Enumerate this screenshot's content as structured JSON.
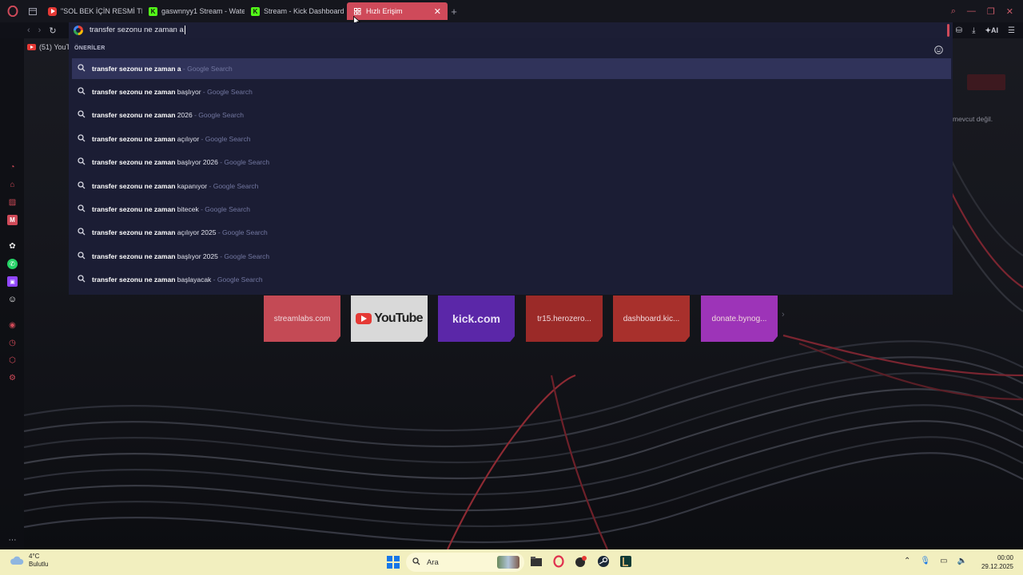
{
  "tabs": [
    {
      "label": "\"SOL BEK İÇİN RESMİ TEK",
      "favicon": "youtube-icon",
      "active": false
    },
    {
      "label": "gaswnnyy1 Stream - Wate",
      "favicon": "kick-icon",
      "active": false
    },
    {
      "label": "Stream - Kick Dashboard",
      "favicon": "kick-icon",
      "active": false
    },
    {
      "label": "Hızlı Erişim",
      "favicon": "speed-dial-icon",
      "active": true
    }
  ],
  "address_bar": {
    "value": "transfer sezonu ne zaman a"
  },
  "bookmark": {
    "label": "(51) YouTu"
  },
  "suggestions": {
    "header": "ÖNERİLER",
    "items": [
      {
        "bold": "transfer sezonu ne zaman a",
        "rest": "",
        "source": "Google Search"
      },
      {
        "bold": "transfer sezonu ne zaman",
        "rest": "başlıyor",
        "source": "Google Search"
      },
      {
        "bold": "transfer sezonu ne zaman",
        "rest": "2026",
        "source": "Google Search"
      },
      {
        "bold": "transfer sezonu ne zaman",
        "rest": "açılıyor",
        "source": "Google Search"
      },
      {
        "bold": "transfer sezonu ne zaman",
        "rest": "başlıyor 2026",
        "source": "Google Search"
      },
      {
        "bold": "transfer sezonu ne zaman",
        "rest": "kapanıyor",
        "source": "Google Search"
      },
      {
        "bold": "transfer sezonu ne zaman",
        "rest": "bitecek",
        "source": "Google Search"
      },
      {
        "bold": "transfer sezonu ne zaman",
        "rest": "açılıyor 2025",
        "source": "Google Search"
      },
      {
        "bold": "transfer sezonu ne zaman",
        "rest": "başlıyor 2025",
        "source": "Google Search"
      },
      {
        "bold": "transfer sezonu ne zaman",
        "rest": "başlayacak",
        "source": "Google Search"
      }
    ]
  },
  "speed_dial": [
    {
      "label": "streamlabs.com",
      "color": "#c44a55"
    },
    {
      "label": "YouTube",
      "color": "#d9d9d9"
    },
    {
      "label": "kick.com",
      "color": "#5b27a8"
    },
    {
      "label": "tr15.herozero...",
      "color": "#9b2a28"
    },
    {
      "label": "dashboard.kic...",
      "color": "#a8302c"
    },
    {
      "label": "donate.bynog...",
      "color": "#9d34b8"
    }
  ],
  "background_text": {
    "partial": "mevcut değil."
  },
  "sidebar_label": "GX",
  "taskbar": {
    "weather_temp": "4°C",
    "weather_desc": "Bulutlu",
    "search_placeholder": "Ara",
    "time": "00:00",
    "date": "29.12.2025"
  },
  "colors": {
    "accent": "#cf4a5a",
    "dropdown": "#1b1d34",
    "selected": "#30335a",
    "taskbar": "#f2efbf"
  }
}
